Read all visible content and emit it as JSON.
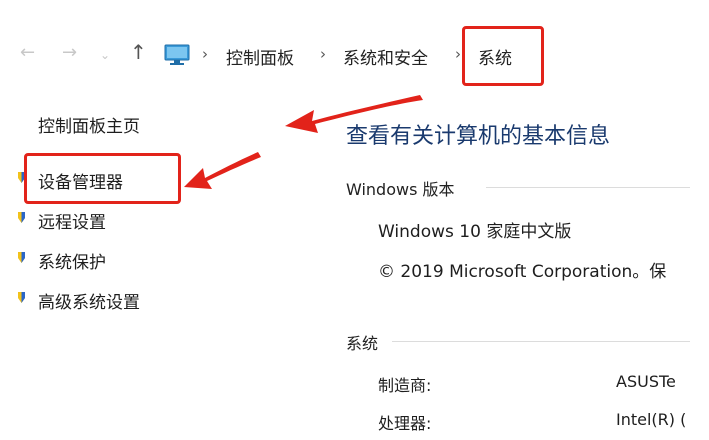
{
  "breadcrumb": {
    "items": [
      "控制面板",
      "系统和安全",
      "系统"
    ]
  },
  "sidebar": {
    "home": "控制面板主页",
    "items": [
      {
        "label": "设备管理器",
        "icon": "shield-icon"
      },
      {
        "label": "远程设置",
        "icon": "shield-icon"
      },
      {
        "label": "系统保护",
        "icon": "shield-icon"
      },
      {
        "label": "高级系统设置",
        "icon": "shield-icon"
      }
    ]
  },
  "main": {
    "title": "查看有关计算机的基本信息",
    "windows_section": {
      "heading": "Windows 版本",
      "edition": "Windows 10 家庭中文版",
      "copyright": "© 2019 Microsoft Corporation。保"
    },
    "system_section": {
      "heading": "系统",
      "rows": [
        {
          "label": "制造商:",
          "value": "ASUSTe"
        },
        {
          "label": "处理器:",
          "value": "Intel(R) ("
        }
      ]
    }
  },
  "colors": {
    "annotation": "#e2231a",
    "title": "#1a3a6e",
    "shield_yellow": "#f2c21b",
    "shield_blue": "#2a66c8"
  }
}
